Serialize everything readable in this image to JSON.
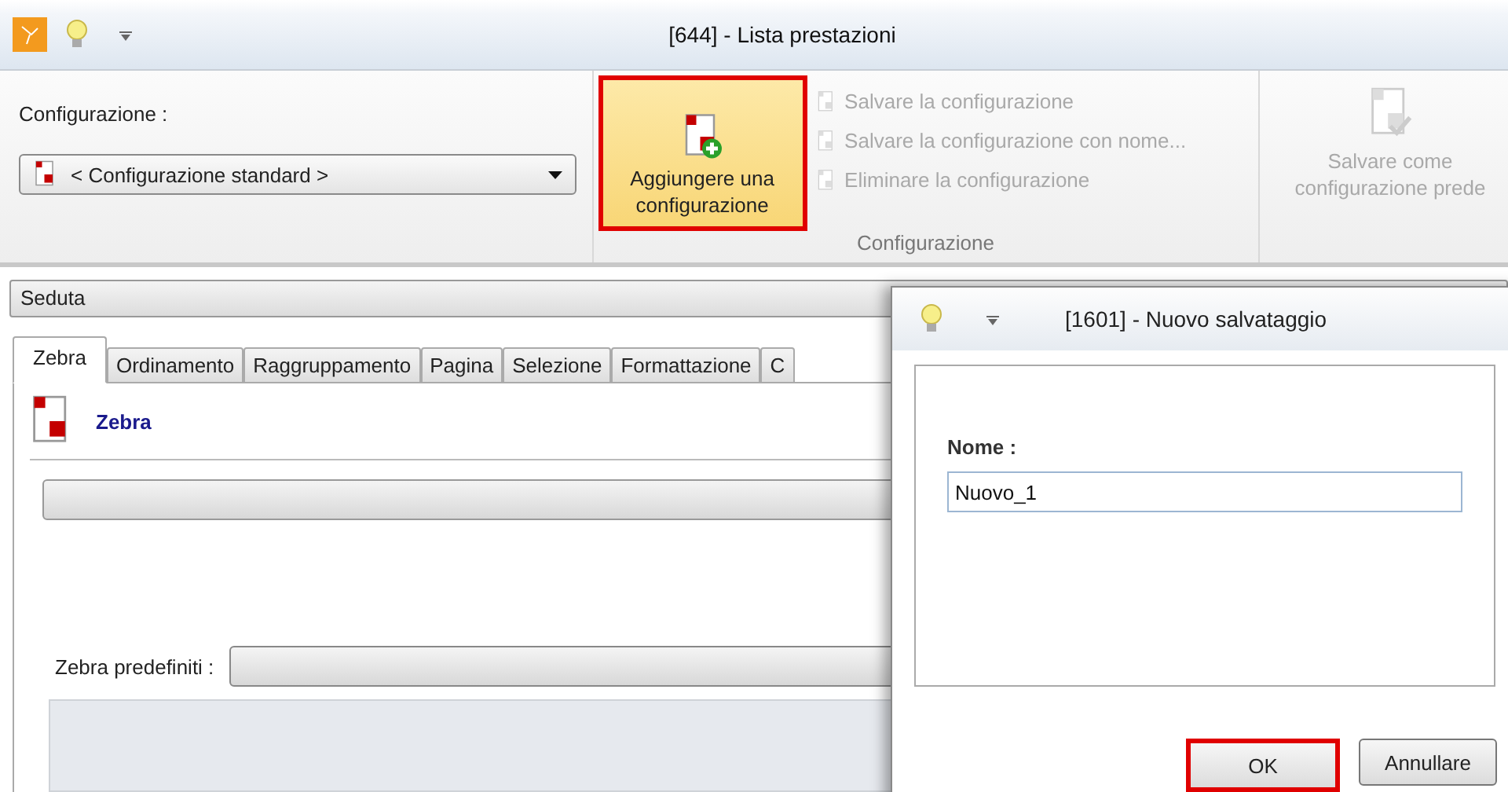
{
  "window": {
    "title": "[644] - Lista prestazioni"
  },
  "ribbon": {
    "config_label": "Configurazione :",
    "config_select": "< Configurazione standard >",
    "add_button": {
      "label": "Aggiungere una configurazione",
      "highlighted": true
    },
    "actions": [
      {
        "label": "Salvare la configurazione",
        "disabled": true
      },
      {
        "label": "Salvare la configurazione con nome...",
        "disabled": true
      },
      {
        "label": "Eliminare la configurazione",
        "disabled": true
      }
    ],
    "group_label": "Configurazione",
    "default_button": {
      "label": "Salvare come configurazione prede",
      "disabled": true
    }
  },
  "section_bar": "Seduta",
  "tabs": [
    {
      "label": "Zebra",
      "selected": true
    },
    {
      "label": "Ordinamento",
      "selected": false
    },
    {
      "label": "Raggruppamento",
      "selected": false
    },
    {
      "label": "Pagina",
      "selected": false
    },
    {
      "label": "Selezione",
      "selected": false
    },
    {
      "label": "Formattazione",
      "selected": false
    },
    {
      "label": "C",
      "selected": false
    }
  ],
  "panel": {
    "title": "Zebra",
    "preset_label": "Zebra predefiniti :"
  },
  "dialog": {
    "title": "[1601] - Nuovo salvataggio",
    "name_label": "Nome :",
    "name_value": "Nuovo_1",
    "buttons": [
      {
        "label": "OK",
        "highlighted": true
      },
      {
        "label": "Annullare",
        "highlighted": false
      }
    ]
  }
}
